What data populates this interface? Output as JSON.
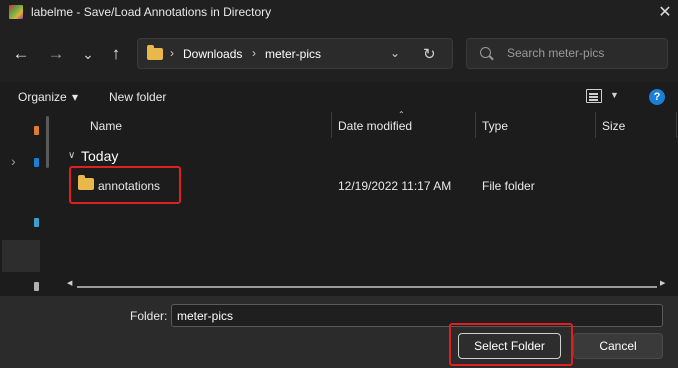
{
  "window": {
    "title": "labelme - Save/Load Annotations in Directory",
    "close_glyph": "✕"
  },
  "nav": {
    "back_glyph": "←",
    "forward_glyph": "→",
    "recent_glyph": "⌄",
    "up_glyph": "↑",
    "separator_glyph": "›",
    "breadcrumb": [
      "Downloads",
      "meter-pics"
    ],
    "dropdown_glyph": "⌄",
    "refresh_glyph": "↻",
    "search_placeholder": "Search meter-pics"
  },
  "toolbar": {
    "organize_label": "Organize",
    "organize_caret": "▾",
    "new_folder_label": "New folder",
    "view_caret": "▼",
    "help_glyph": "?"
  },
  "navpane": {
    "expand_glyph": "›"
  },
  "file_list": {
    "columns": [
      "Name",
      "Date modified",
      "Type",
      "Size"
    ],
    "sort_caret": "⌃",
    "group": {
      "chevron": "∨",
      "label": "Today"
    },
    "rows": [
      {
        "name": "annotations",
        "date_modified": "12/19/2022 11:17 AM",
        "type": "File folder",
        "size": ""
      }
    ],
    "scroll_left_glyph": "◀",
    "scroll_right_glyph": "▶"
  },
  "footer": {
    "folder_label": "Folder:",
    "folder_value": "meter-pics",
    "select_label": "Select Folder",
    "cancel_label": "Cancel"
  },
  "colors": {
    "highlight": "#e02020",
    "folder_icon": "#e8b94a",
    "accent": "#1a7fd6"
  }
}
